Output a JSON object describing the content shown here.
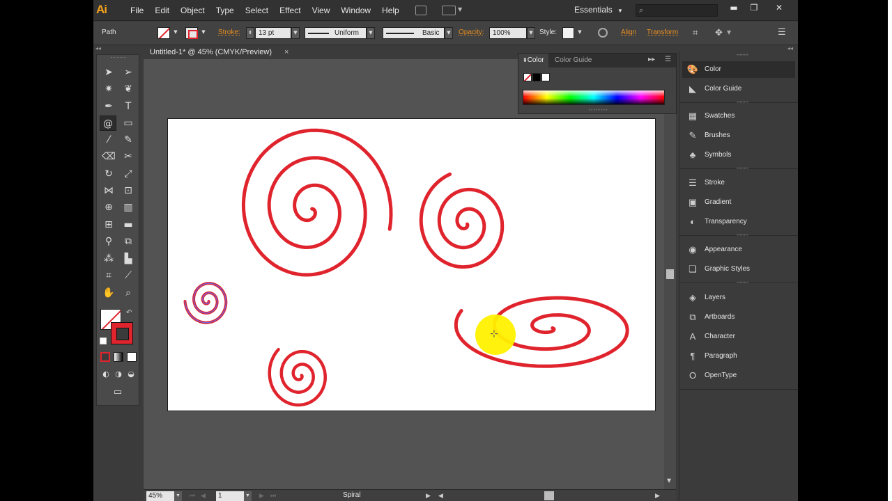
{
  "app": {
    "logo": "Ai",
    "menu": [
      "File",
      "Edit",
      "Object",
      "Type",
      "Select",
      "Effect",
      "View",
      "Window",
      "Help"
    ],
    "workspace": "Essentials",
    "window_controls": {
      "minimize": "▬",
      "restore": "❐",
      "close": "✕"
    }
  },
  "controlbar": {
    "selection_label": "Path",
    "stroke_label": "Stroke:",
    "stroke_value": "13 pt",
    "profile_value": "Uniform",
    "brush_value": "Basic",
    "opacity_label": "Opacity:",
    "opacity_value": "100%",
    "style_label": "Style:",
    "align_label": "Align",
    "transform_label": "Transform"
  },
  "document": {
    "tab_title": "Untitled-1* @ 45% (CMYK/Preview)",
    "close": "×"
  },
  "statusbar": {
    "zoom": "45%",
    "artboard_number": "1",
    "current_tool": "Spiral"
  },
  "color_panel": {
    "tab_color": "Color",
    "tab_guide": "Color Guide"
  },
  "dock": {
    "groups": [
      [
        {
          "label": "Color",
          "icon": "palette-icon",
          "glyph": "🎨"
        },
        {
          "label": "Color Guide",
          "icon": "color-guide-icon",
          "glyph": "◣"
        }
      ],
      [
        {
          "label": "Swatches",
          "icon": "swatches-icon",
          "glyph": "▦"
        },
        {
          "label": "Brushes",
          "icon": "brush-icon",
          "glyph": "✎"
        },
        {
          "label": "Symbols",
          "icon": "symbols-icon",
          "glyph": "♣"
        }
      ],
      [
        {
          "label": "Stroke",
          "icon": "stroke-icon",
          "glyph": "☰"
        },
        {
          "label": "Gradient",
          "icon": "gradient-icon",
          "glyph": "▣"
        },
        {
          "label": "Transparency",
          "icon": "transparency-icon",
          "glyph": "◐"
        }
      ],
      [
        {
          "label": "Appearance",
          "icon": "appearance-icon",
          "glyph": "◉"
        },
        {
          "label": "Graphic Styles",
          "icon": "graphic-styles-icon",
          "glyph": "❑"
        }
      ],
      [
        {
          "label": "Layers",
          "icon": "layers-icon",
          "glyph": "◈"
        },
        {
          "label": "Artboards",
          "icon": "artboards-icon",
          "glyph": "⧉"
        },
        {
          "label": "Character",
          "icon": "character-icon",
          "glyph": "A"
        },
        {
          "label": "Paragraph",
          "icon": "paragraph-icon",
          "glyph": "¶"
        },
        {
          "label": "OpenType",
          "icon": "opentype-icon",
          "glyph": "O"
        }
      ]
    ]
  },
  "colors": {
    "spiral_stroke": "#e0242d",
    "accent_orange": "#e88f21",
    "cursor_highlight": "#fff100"
  }
}
